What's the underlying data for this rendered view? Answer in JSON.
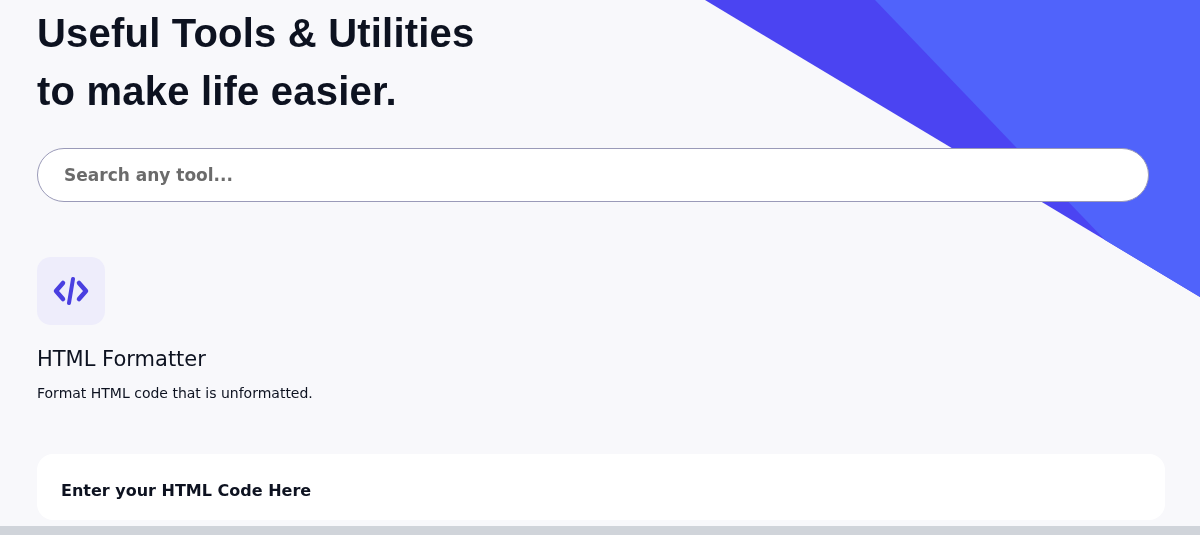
{
  "hero": {
    "headline_lines": [
      "Useful Tools & Utilities",
      "to make life easier."
    ],
    "search": {
      "placeholder": "Search any tool..."
    }
  },
  "tool": {
    "title": "HTML Formatter",
    "description": "Format HTML code that is unformatted."
  },
  "input_card": {
    "label": "Enter your HTML Code Here"
  }
}
